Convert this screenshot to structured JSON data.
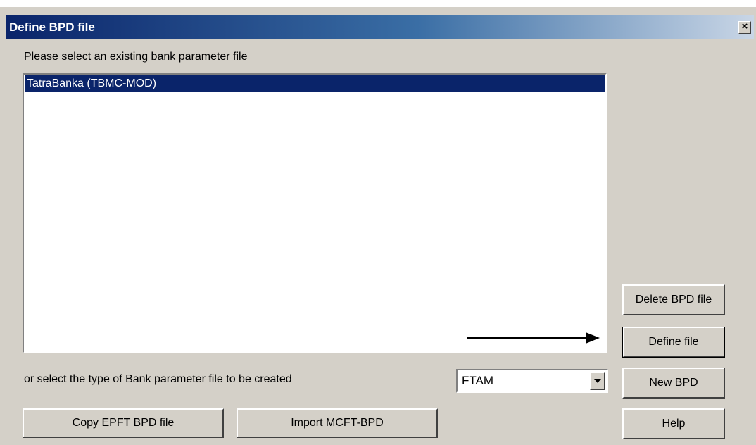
{
  "window": {
    "title": "Define BPD file",
    "close_glyph": "×"
  },
  "prompt_select": "Please select an existing bank parameter file",
  "list": {
    "items": [
      "TatraBanka (TBMC-MOD)"
    ]
  },
  "prompt_create": "or select the type of Bank parameter file to be created",
  "type_select": {
    "value": "FTAM"
  },
  "buttons": {
    "delete": "Delete BPD file",
    "define": "Define file",
    "new": "New BPD",
    "help": "Help",
    "copy": "Copy EPFT BPD file",
    "import": "Import MCFT-BPD"
  },
  "colors": {
    "selection": "#0a246a",
    "dialog_bg": "#d4d0c8"
  }
}
